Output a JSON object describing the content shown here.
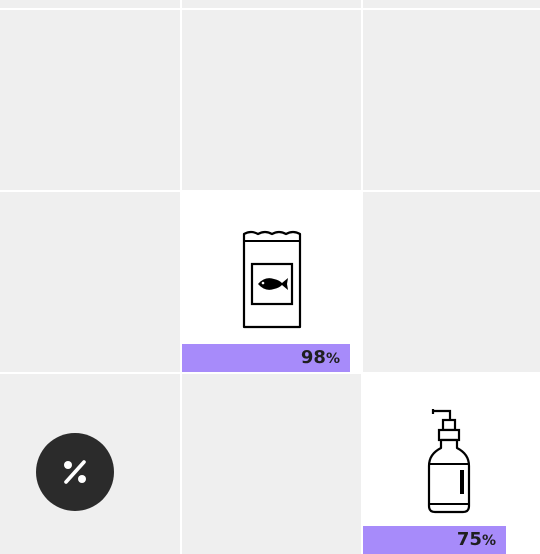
{
  "grid": {
    "cells": [
      {
        "id": "food",
        "progress": {
          "value": "98",
          "unit": "%",
          "fraction": 0.98,
          "color": "#a78bfa"
        },
        "icon": "fish-food-bag-icon"
      },
      {
        "id": "shampoo",
        "progress": {
          "value": "75",
          "unit": "%",
          "fraction": 0.75,
          "color": "#a78bfa"
        },
        "icon": "pump-bottle-icon"
      }
    ],
    "discount": {
      "icon": "percent-icon"
    },
    "colors": {
      "empty_cell": "#efefef",
      "active_cell": "#ffffff",
      "discount_bg": "#2b2b2b"
    }
  }
}
